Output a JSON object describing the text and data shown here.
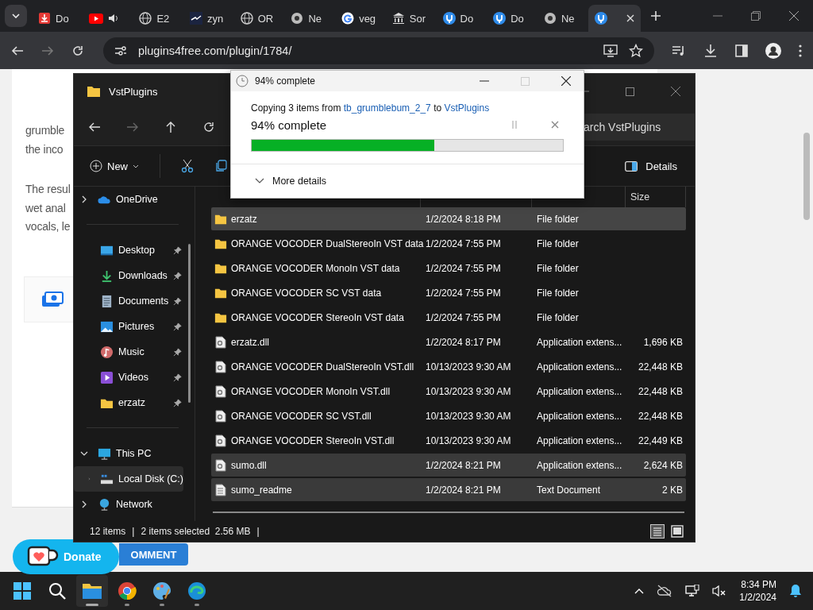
{
  "browser": {
    "tabs": [
      {
        "title": "Do",
        "kind": "download",
        "audio": false,
        "selected": false
      },
      {
        "kind": "video",
        "audio": true,
        "selected": false
      },
      {
        "title": "E2",
        "kind": "globe",
        "audio": false,
        "selected": false
      },
      {
        "title": "zyn",
        "kind": "wave",
        "audio": false,
        "selected": false
      },
      {
        "title": "OR",
        "kind": "globe",
        "audio": false,
        "selected": false
      },
      {
        "title": "Ne",
        "kind": "chrome",
        "audio": false,
        "selected": false
      },
      {
        "title": "veg",
        "kind": "search",
        "audio": false,
        "selected": false
      },
      {
        "title": "Sor",
        "kind": "museum",
        "audio": false,
        "selected": false
      },
      {
        "title": "Do",
        "kind": "plug",
        "audio": false,
        "selected": false
      },
      {
        "title": "Do",
        "kind": "plug",
        "audio": false,
        "selected": false
      },
      {
        "title": "Ne",
        "kind": "chrome",
        "audio": false,
        "selected": false
      },
      {
        "kind": "plug",
        "audio": false,
        "selected": true
      }
    ],
    "url": "plugins4free.com/plugin/1784/"
  },
  "page": {
    "paragraphs": [
      [
        "grumble",
        "the inco"
      ],
      [
        "The resul",
        "wet anal",
        "vocals, le"
      ]
    ],
    "donate": "Donate",
    "comment": "OMMENT"
  },
  "explorer": {
    "title": "VstPlugins",
    "search": {
      "placeholder": "arch VstPlugins"
    },
    "new_label": "New",
    "details_label": "Details",
    "nav_top": [
      {
        "label": "OneDrive",
        "kind": "cloud",
        "expanded": false,
        "selected": false
      }
    ],
    "quick_access": [
      {
        "label": "Desktop",
        "kind": "desktop",
        "pinned": true
      },
      {
        "label": "Downloads",
        "kind": "download",
        "pinned": true
      },
      {
        "label": "Documents",
        "kind": "document",
        "pinned": true
      },
      {
        "label": "Pictures",
        "kind": "pictures",
        "pinned": true
      },
      {
        "label": "Music",
        "kind": "music",
        "pinned": true
      },
      {
        "label": "Videos",
        "kind": "videos",
        "pinned": true
      },
      {
        "label": "erzatz",
        "kind": "folder",
        "pinned": true
      }
    ],
    "tree": [
      {
        "label": "This PC",
        "kind": "pc",
        "expanded": true,
        "selected": false,
        "children": [
          {
            "label": "Local Disk (C:)",
            "kind": "disk",
            "expanded": false,
            "selected": true
          }
        ]
      },
      {
        "label": "Network",
        "kind": "network",
        "expanded": false,
        "selected": false
      }
    ],
    "size_header": "Size",
    "files": [
      {
        "name": "erzatz",
        "date": "1/2/2024 8:18 PM",
        "type": "File folder",
        "kind": "folder",
        "selected": false,
        "hover": true
      },
      {
        "name": "ORANGE VOCODER DualStereoIn VST data",
        "date": "1/2/2024 7:55 PM",
        "type": "File folder",
        "kind": "folder",
        "selected": false,
        "hover": false
      },
      {
        "name": "ORANGE VOCODER MonoIn VST data",
        "date": "1/2/2024 7:55 PM",
        "type": "File folder",
        "kind": "folder",
        "selected": false,
        "hover": false
      },
      {
        "name": "ORANGE VOCODER SC VST data",
        "date": "1/2/2024 7:55 PM",
        "type": "File folder",
        "kind": "folder",
        "selected": false,
        "hover": false
      },
      {
        "name": "ORANGE VOCODER StereoIn VST data",
        "date": "1/2/2024 7:55 PM",
        "type": "File folder",
        "kind": "folder",
        "selected": false,
        "hover": false
      },
      {
        "name": "erzatz.dll",
        "date": "1/2/2024 8:17 PM",
        "type": "Application extens...",
        "size": "1,696 KB",
        "kind": "dll",
        "selected": false,
        "hover": false
      },
      {
        "name": "ORANGE VOCODER DualStereoIn VST.dll",
        "date": "10/13/2023 9:30 AM",
        "type": "Application extens...",
        "size": "22,448 KB",
        "kind": "dll",
        "selected": false,
        "hover": false
      },
      {
        "name": "ORANGE VOCODER MonoIn VST.dll",
        "date": "10/13/2023 9:30 AM",
        "type": "Application extens...",
        "size": "22,448 KB",
        "kind": "dll",
        "selected": false,
        "hover": false
      },
      {
        "name": "ORANGE VOCODER SC VST.dll",
        "date": "10/13/2023 9:30 AM",
        "type": "Application extens...",
        "size": "22,448 KB",
        "kind": "dll",
        "selected": false,
        "hover": false
      },
      {
        "name": "ORANGE VOCODER StereoIn VST.dll",
        "date": "10/13/2023 9:30 AM",
        "type": "Application extens...",
        "size": "22,449 KB",
        "kind": "dll",
        "selected": false,
        "hover": false
      },
      {
        "name": "sumo.dll",
        "date": "1/2/2024 8:21 PM",
        "type": "Application extens...",
        "size": "2,624 KB",
        "kind": "dll",
        "selected": true,
        "hover": false
      },
      {
        "name": "sumo_readme",
        "date": "1/2/2024 8:21 PM",
        "type": "Text Document",
        "size": "2 KB",
        "kind": "text",
        "selected": true,
        "hover": false
      }
    ],
    "status": {
      "count": "12 items",
      "sep1": "|",
      "selection": "2 items selected  2.56 MB",
      "sep2": "|"
    }
  },
  "dialog": {
    "title": "94% complete",
    "pre": "Copying 3 items from ",
    "source": "tb_grumblebum_2_7",
    "mid": " to ",
    "target": "VstPlugins",
    "heading": "94% complete",
    "level": 0.586,
    "more": "More details"
  },
  "taskbar": {
    "apps": [
      {
        "kind": "start",
        "active": false
      },
      {
        "kind": "search",
        "active": false
      },
      {
        "kind": "explorer",
        "active": true
      },
      {
        "kind": "chrome",
        "active": false
      },
      {
        "kind": "paint",
        "active": false
      },
      {
        "kind": "edge",
        "active": false
      }
    ],
    "time": "8:34 PM",
    "date": "1/2/2024"
  }
}
